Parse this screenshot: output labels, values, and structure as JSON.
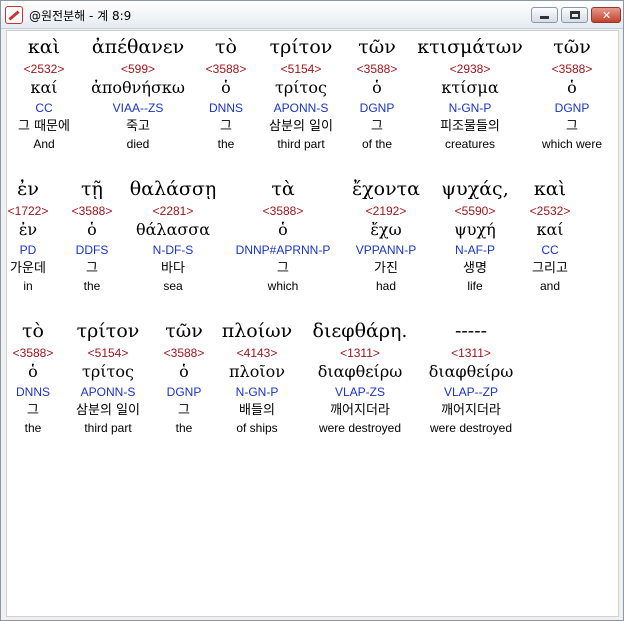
{
  "window": {
    "title": "@원전분해 - 계 8:9"
  },
  "rows": [
    [
      {
        "greek": "καὶ",
        "strong": "<2532>",
        "lemma": "καί",
        "parse": "CC",
        "korean": "그 때문에",
        "english": "And"
      },
      {
        "greek": "ἀπέθανεν",
        "strong": "<599>",
        "lemma": "ἀποθνήσκω",
        "parse": "VIAA--ZS",
        "korean": "죽고",
        "english": "died"
      },
      {
        "greek": "τὸ",
        "strong": "<3588>",
        "lemma": "ὁ",
        "parse": "DNNS",
        "korean": "그",
        "english": "the"
      },
      {
        "greek": "τρίτον",
        "strong": "<5154>",
        "lemma": "τρίτος",
        "parse": "APONN-S",
        "korean": "삼분의 일이",
        "english": "third part"
      },
      {
        "greek": "τῶν",
        "strong": "<3588>",
        "lemma": "ὁ",
        "parse": "DGNP",
        "korean": "그",
        "english": "of the"
      },
      {
        "greek": "κτισμάτων",
        "strong": "<2938>",
        "lemma": "κτίσμα",
        "parse": "N-GN-P",
        "korean": "피조물들의",
        "english": "creatures"
      },
      {
        "greek": "τῶν",
        "strong": "<3588>",
        "lemma": "ὁ",
        "parse": "DGNP",
        "korean": "그",
        "english": "which were"
      }
    ],
    [
      {
        "greek": "ἐν",
        "strong": "<1722>",
        "lemma": "ἐν",
        "parse": "PD",
        "korean": "가운데",
        "english": "in"
      },
      {
        "greek": "τῇ",
        "strong": "<3588>",
        "lemma": "ὁ",
        "parse": "DDFS",
        "korean": "그",
        "english": "the"
      },
      {
        "greek": "θαλάσσῃ",
        "strong": "<2281>",
        "lemma": "θάλασσα",
        "parse": "N-DF-S",
        "korean": "바다",
        "english": "sea"
      },
      {
        "greek": "τὰ",
        "strong": "<3588>",
        "lemma": "ὁ",
        "parse": "DNNP#APRNN-P",
        "korean": "그",
        "english": "which"
      },
      {
        "greek": "ἔχοντα",
        "strong": "<2192>",
        "lemma": "ἔχω",
        "parse": "VPPANN-P",
        "korean": "가진",
        "english": "had"
      },
      {
        "greek": "ψυχάς,",
        "strong": "<5590>",
        "lemma": "ψυχή",
        "parse": "N-AF-P",
        "korean": "생명",
        "english": "life"
      },
      {
        "greek": "καὶ",
        "strong": "<2532>",
        "lemma": "καί",
        "parse": "CC",
        "korean": "그리고",
        "english": "and"
      }
    ],
    [
      {
        "greek": "τὸ",
        "strong": "<3588>",
        "lemma": "ὁ",
        "parse": "DNNS",
        "korean": "그",
        "english": "the"
      },
      {
        "greek": "τρίτον",
        "strong": "<5154>",
        "lemma": "τρίτος",
        "parse": "APONN-S",
        "korean": "삼분의 일이",
        "english": "third part"
      },
      {
        "greek": "τῶν",
        "strong": "<3588>",
        "lemma": "ὁ",
        "parse": "DGNP",
        "korean": "그",
        "english": "the"
      },
      {
        "greek": "πλοίων",
        "strong": "<4143>",
        "lemma": "πλοῖον",
        "parse": "N-GN-P",
        "korean": "배들의",
        "english": "of ships"
      },
      {
        "greek": "διεφθάρη.",
        "strong": "<1311>",
        "lemma": "διαφθείρω",
        "parse": "VLAP-ZS",
        "korean": "깨어지더라",
        "english": "were destroyed"
      },
      {
        "greek": "-----",
        "strong": "<1311>",
        "lemma": "διαφθείρω",
        "parse": "VLAP--ZP",
        "korean": "깨어지더라",
        "english": "were destroyed"
      }
    ]
  ]
}
